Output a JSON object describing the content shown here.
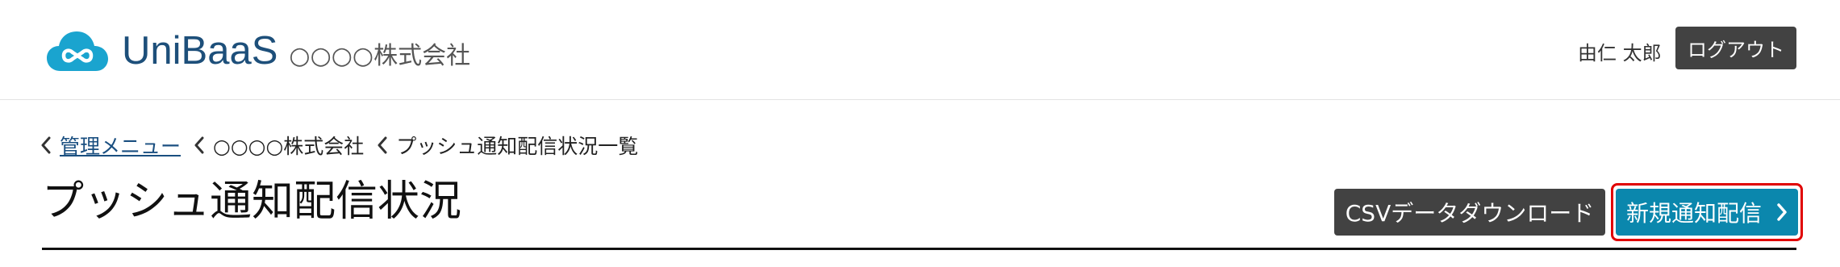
{
  "header": {
    "brand": "UniBaaS",
    "company": "○○○○株式会社",
    "user_name": "由仁 太郎",
    "logout_label": "ログアウト",
    "brand_color": "#1d4f7a",
    "logo_color": "#1aa4cf"
  },
  "breadcrumb": {
    "items": [
      {
        "label": "管理メニュー",
        "link": true
      },
      {
        "label": "○○○○株式会社",
        "link": false
      },
      {
        "label": "プッシュ通知配信状況一覧",
        "link": false
      }
    ]
  },
  "main": {
    "title": "プッシュ通知配信状況",
    "csv_button_label": "CSVデータダウンロード",
    "new_button_label": "新規通知配信",
    "new_button_icon": "chevron-right-icon",
    "new_button_color": "#0b87ad"
  }
}
